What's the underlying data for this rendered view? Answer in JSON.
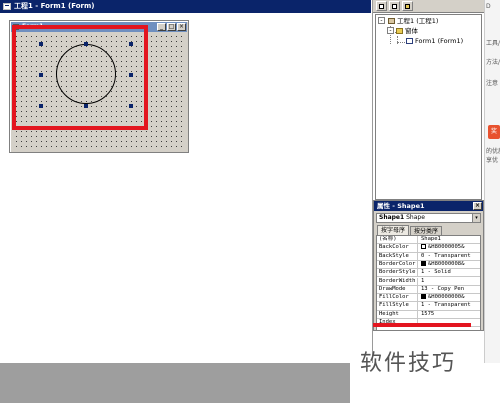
{
  "designer": {
    "title": "工程1 - Form1 (Form)"
  },
  "form1": {
    "caption": "Form1",
    "min_label": "_",
    "max_label": "□",
    "close_label": "×"
  },
  "project": {
    "tree": [
      {
        "label": "工程1 (工程1)",
        "expander": "-"
      },
      {
        "label": "窗体",
        "expander": "-"
      },
      {
        "label": "Form1 (Form1)"
      }
    ]
  },
  "properties": {
    "title": "属性 - Shape1",
    "close_label": "×",
    "object_name": "Shape1",
    "object_type": "Shape",
    "dropdown_glyph": "▾",
    "tabs": [
      "按字母序",
      "按分类序"
    ],
    "rows": [
      {
        "name": "(名称)",
        "value": "Shape1"
      },
      {
        "name": "BackColor",
        "value": "&H80000005&",
        "swatch": "#ffffff"
      },
      {
        "name": "BackStyle",
        "value": "0 - Transparent"
      },
      {
        "name": "BorderColor",
        "value": "&H80000008&",
        "swatch": "#000000"
      },
      {
        "name": "BorderStyle",
        "value": "1 - Solid"
      },
      {
        "name": "BorderWidth",
        "value": "1"
      },
      {
        "name": "DrawMode",
        "value": "13 - Copy Pen"
      },
      {
        "name": "FillColor",
        "value": "&H00000000&",
        "swatch": "#000000"
      },
      {
        "name": "FillStyle",
        "value": "1 - Transparent"
      },
      {
        "name": "Height",
        "value": "1575"
      },
      {
        "name": "Index",
        "value": ""
      }
    ]
  },
  "browser_edge": {
    "items": [
      "D",
      "工具/",
      "方法/",
      "注意"
    ],
    "red_button_label": "奖",
    "snippet_1": "的优质",
    "snippet_2": "享优"
  },
  "watermark": "软件技巧",
  "colors": {
    "titlebar": "#0a246a",
    "highlight": "#e3151f",
    "dialog_face": "#d4d0c8"
  }
}
